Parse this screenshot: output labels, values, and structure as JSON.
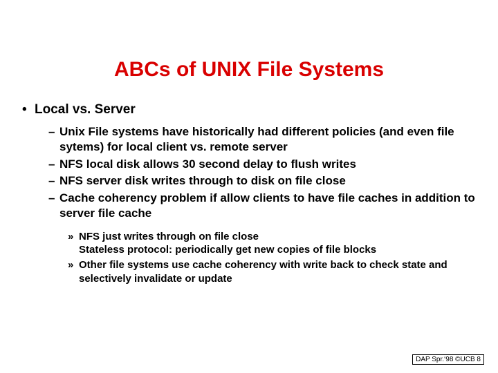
{
  "title": "ABCs of UNIX File Systems",
  "lvl1": {
    "bullet": "•",
    "text": "Local vs. Server"
  },
  "lvl2": {
    "a": "Unix File systems have historically had different policies (and even file sytems) for local client vs. remote server",
    "b": "NFS local disk allows 30 second delay to flush writes",
    "c": "NFS server disk writes through to disk on file close",
    "d": "Cache coherency problem if allow clients to have file caches in addition to server file cache"
  },
  "lvl3": {
    "a_line1": "NFS just writes through on file close",
    "a_line2": "Stateless protocol: periodically get new copies of file blocks",
    "b": "Other file systems use cache coherency with write back to check state and selectively invalidate or update"
  },
  "marks": {
    "dash": "–",
    "raquo": "»"
  },
  "footer": "DAP Spr.‘98 ©UCB 8"
}
